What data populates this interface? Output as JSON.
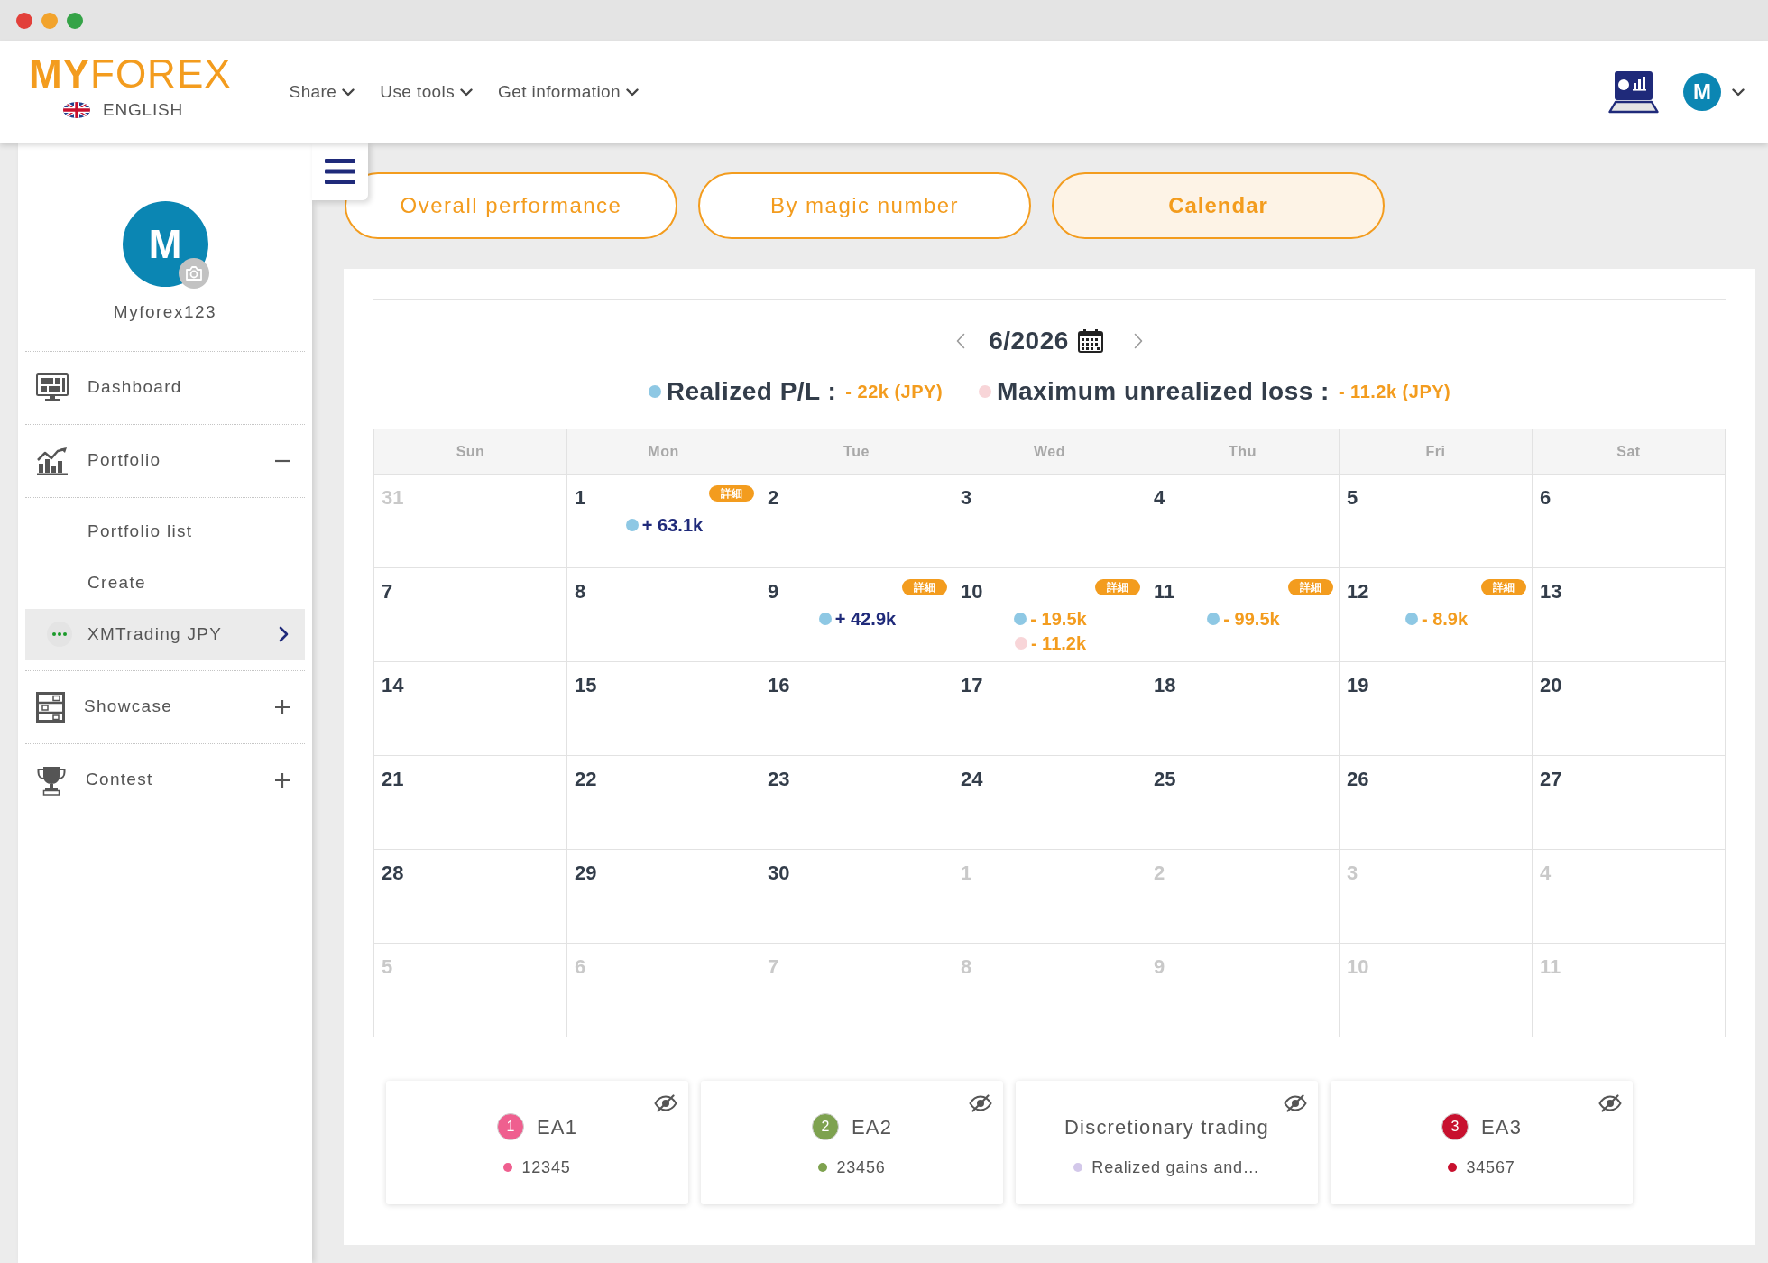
{
  "header": {
    "logo": "**MY**FOREX",
    "language": "ENGLISH",
    "nav": [
      {
        "label": "Share"
      },
      {
        "label": "Use tools"
      },
      {
        "label": "Get information"
      }
    ],
    "avatar_initial": "M"
  },
  "sidebar": {
    "avatar_initial": "M",
    "username": "Myforex123",
    "items": [
      {
        "kind": "link",
        "label": "Dashboard"
      },
      {
        "kind": "group",
        "label": "Portfolio",
        "expanded": true,
        "children": [
          {
            "kind": "link",
            "label": "Portfolio list",
            "selected": false
          },
          {
            "kind": "link",
            "label": "Create",
            "selected": false
          },
          {
            "kind": "account",
            "label": "XMTrading JPY",
            "selected": true
          }
        ]
      },
      {
        "kind": "group",
        "label": "Showcase",
        "expanded": false
      },
      {
        "kind": "group",
        "label": "Contest",
        "expanded": false
      }
    ]
  },
  "tabs": [
    {
      "label": "Overall performance",
      "selected": false
    },
    {
      "label": "By magic number",
      "selected": false
    },
    {
      "label": "Calendar",
      "selected": true
    }
  ],
  "calendar": {
    "month": "6/2026",
    "legend": [
      {
        "label": "Realized P/L :",
        "value": "- 22k (JPY)",
        "negative": true,
        "color": "#8ec8e4"
      },
      {
        "label": "Maximum unrealized loss :",
        "value": "- 11.2k (JPY)",
        "negative": true,
        "color": "#f8d5d8"
      }
    ],
    "weekdays": [
      "Sun",
      "Mon",
      "Tue",
      "Wed",
      "Thu",
      "Fri",
      "Sat"
    ],
    "weeks": [
      [
        {
          "day": "31",
          "outside_month": true
        },
        {
          "day": "1",
          "outside_month": false,
          "detail_button": "詳細",
          "entries": [
            {
              "value": "+ 63.1k",
              "negative": false,
              "color": "#8ec8e4"
            }
          ]
        },
        {
          "day": "2",
          "outside_month": false
        },
        {
          "day": "3",
          "outside_month": false
        },
        {
          "day": "4",
          "outside_month": false
        },
        {
          "day": "5",
          "outside_month": false
        },
        {
          "day": "6",
          "outside_month": false
        }
      ],
      [
        {
          "day": "7",
          "outside_month": false
        },
        {
          "day": "8",
          "outside_month": false
        },
        {
          "day": "9",
          "outside_month": false,
          "detail_button": "詳細",
          "entries": [
            {
              "value": "+ 42.9k",
              "negative": false,
              "color": "#8ec8e4"
            }
          ]
        },
        {
          "day": "10",
          "outside_month": false,
          "detail_button": "詳細",
          "entries": [
            {
              "value": "- 19.5k",
              "negative": true,
              "color": "#8ec8e4"
            },
            {
              "value": "- 11.2k",
              "negative": true,
              "color": "#f8d5d8"
            }
          ]
        },
        {
          "day": "11",
          "outside_month": false,
          "detail_button": "詳細",
          "entries": [
            {
              "value": "- 99.5k",
              "negative": true,
              "color": "#8ec8e4"
            }
          ]
        },
        {
          "day": "12",
          "outside_month": false,
          "detail_button": "詳細",
          "entries": [
            {
              "value": "- 8.9k",
              "negative": true,
              "color": "#8ec8e4"
            }
          ]
        },
        {
          "day": "13",
          "outside_month": false
        }
      ],
      [
        {
          "day": "14",
          "outside_month": false
        },
        {
          "day": "15",
          "outside_month": false
        },
        {
          "day": "16",
          "outside_month": false
        },
        {
          "day": "17",
          "outside_month": false
        },
        {
          "day": "18",
          "outside_month": false
        },
        {
          "day": "19",
          "outside_month": false
        },
        {
          "day": "20",
          "outside_month": false
        }
      ],
      [
        {
          "day": "21",
          "outside_month": false
        },
        {
          "day": "22",
          "outside_month": false
        },
        {
          "day": "23",
          "outside_month": false
        },
        {
          "day": "24",
          "outside_month": false
        },
        {
          "day": "25",
          "outside_month": false
        },
        {
          "day": "26",
          "outside_month": false
        },
        {
          "day": "27",
          "outside_month": false
        }
      ],
      [
        {
          "day": "28",
          "outside_month": false
        },
        {
          "day": "29",
          "outside_month": false
        },
        {
          "day": "30",
          "outside_month": false
        },
        {
          "day": "1",
          "outside_month": true
        },
        {
          "day": "2",
          "outside_month": true
        },
        {
          "day": "3",
          "outside_month": true
        },
        {
          "day": "4",
          "outside_month": true
        }
      ],
      [
        {
          "day": "5",
          "outside_month": true
        },
        {
          "day": "6",
          "outside_month": true
        },
        {
          "day": "7",
          "outside_month": true
        },
        {
          "day": "8",
          "outside_month": true
        },
        {
          "day": "9",
          "outside_month": true
        },
        {
          "day": "10",
          "outside_month": true
        },
        {
          "day": "11",
          "outside_month": true
        }
      ]
    ]
  },
  "strategies": [
    {
      "badge": "1",
      "name": "EA1",
      "color": "#ef5f8f",
      "detail": "12345"
    },
    {
      "badge": "2",
      "name": "EA2",
      "color": "#7ea24f",
      "detail": "23456"
    },
    {
      "name": "Discretionary trading",
      "color": "#d3c8ea",
      "detail": "Realized gains and…"
    },
    {
      "badge": "3",
      "name": "EA3",
      "color": "#c8102e",
      "detail": "34567"
    }
  ]
}
